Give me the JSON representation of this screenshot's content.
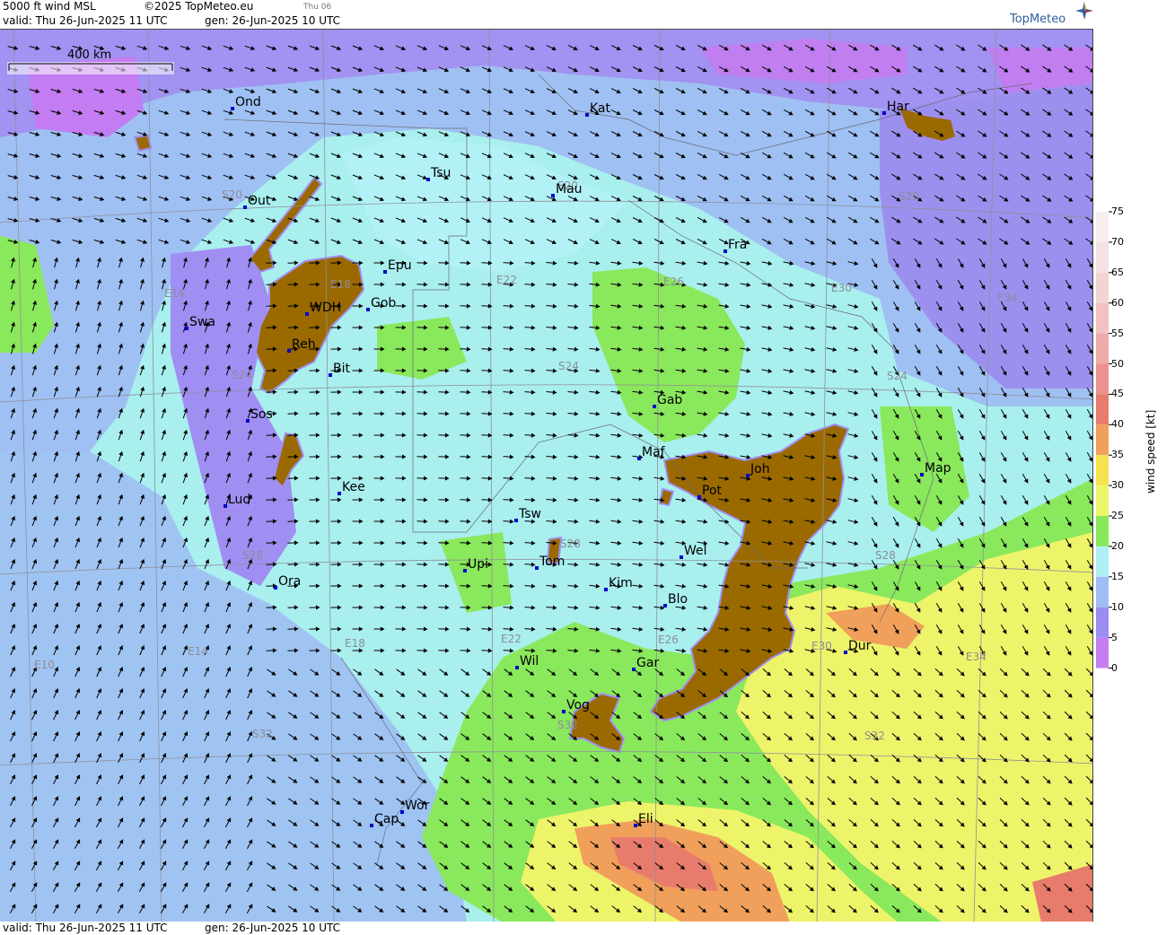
{
  "header": {
    "product": "5000 ft wind MSL",
    "copyright": "©2025 TopMeteo.eu",
    "small_tag": "Thu 06",
    "valid": "valid:  Thu   26-Jun-2025  11 UTC",
    "gen": "gen:  26-Jun-2025 10 UTC",
    "logo": "TopMeteo"
  },
  "footer": {
    "valid": "valid:  Thu   26-Jun-2025  11 UTC",
    "gen": "gen:  26-Jun-2025 10 UTC"
  },
  "scale_bar": {
    "label": "400 km"
  },
  "cities": [
    {
      "name": "Ond"
    },
    {
      "name": "Kat"
    },
    {
      "name": "Har"
    },
    {
      "name": "Tsu"
    },
    {
      "name": "Mau"
    },
    {
      "name": "Out"
    },
    {
      "name": "Fra"
    },
    {
      "name": "Epu"
    },
    {
      "name": "WDH"
    },
    {
      "name": "Gob"
    },
    {
      "name": "Swa"
    },
    {
      "name": "Reh"
    },
    {
      "name": "Bit"
    },
    {
      "name": "Gab"
    },
    {
      "name": "Sos"
    },
    {
      "name": "Maf"
    },
    {
      "name": "Joh"
    },
    {
      "name": "Map"
    },
    {
      "name": "Pot"
    },
    {
      "name": "Lud"
    },
    {
      "name": "Kee"
    },
    {
      "name": "Tsw"
    },
    {
      "name": "Tom"
    },
    {
      "name": "Wel"
    },
    {
      "name": "Upi"
    },
    {
      "name": "Kim"
    },
    {
      "name": "Ora"
    },
    {
      "name": "Blo"
    },
    {
      "name": "Dur"
    },
    {
      "name": "Wil"
    },
    {
      "name": "Gar"
    },
    {
      "name": "Vog"
    },
    {
      "name": "Wor"
    },
    {
      "name": "Cap"
    },
    {
      "name": "Eli"
    }
  ],
  "grid_labels": [
    "S20",
    "S20",
    "S20",
    "E14",
    "E18",
    "E22",
    "E26",
    "E30",
    "E34",
    "S24",
    "S24",
    "S24",
    "S28",
    "S28",
    "S28",
    "E10",
    "E14",
    "E18",
    "E22",
    "E26",
    "E30",
    "E34",
    "S32",
    "S32",
    "S32"
  ],
  "legend": {
    "title": "wind speed  [kt]",
    "ticks": [
      "75",
      "70",
      "65",
      "60",
      "55",
      "50",
      "45",
      "40",
      "35",
      "30",
      "25",
      "20",
      "15",
      "10",
      "5",
      "0"
    ],
    "colors": [
      "#ffffff",
      "#f7eeee",
      "#f5e2e2",
      "#f3d3d3",
      "#f2c2c2",
      "#efaaaa",
      "#ec9090",
      "#e87c6c",
      "#f0a05a",
      "#f6e24e",
      "#ecf56a",
      "#86e85a",
      "#b0f0f4",
      "#9dbdf4",
      "#9a8cf0",
      "#c57ef2"
    ],
    "brown_mask_color": "#9a6a00"
  }
}
